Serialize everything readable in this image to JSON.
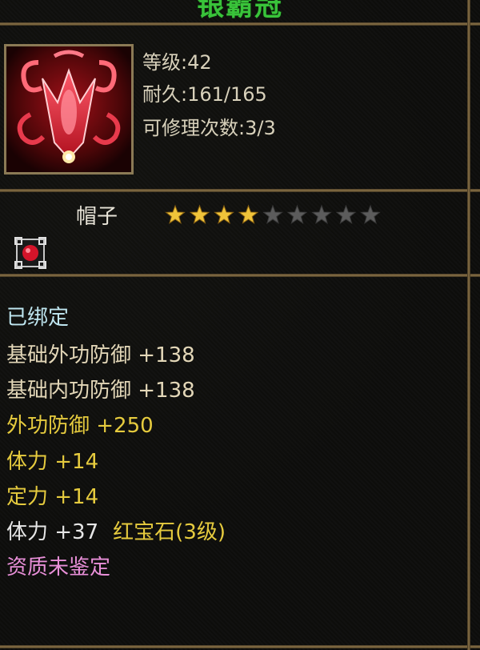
{
  "item": {
    "name": "银霸冠",
    "level_text": "等级:42",
    "durability_text": "耐久:161/165",
    "repair_text": "可修理次数:3/3",
    "icon": "red-crown-helmet-icon",
    "type": "帽子",
    "star_rating": {
      "filled": 4,
      "total": 9
    },
    "socket_icon": "red-gem-socket-icon"
  },
  "properties": {
    "bound": "已绑定",
    "base_outer_def": "基础外功防御 +138",
    "base_inner_def": "基础内功防御 +138",
    "outer_def": "外功防御 +250",
    "stamina": "体力 +14",
    "focus": "定力 +14",
    "gem_stamina": "体力 +37",
    "gem_name": "红宝石(3级)",
    "quality": "资质未鉴定"
  },
  "colors": {
    "name": "#39c33a",
    "bound": "#bfe6f0",
    "base": "#e3d7b8",
    "bonus": "#e6cb3e",
    "quality": "#e88fd8",
    "frame": "#8c7448"
  }
}
